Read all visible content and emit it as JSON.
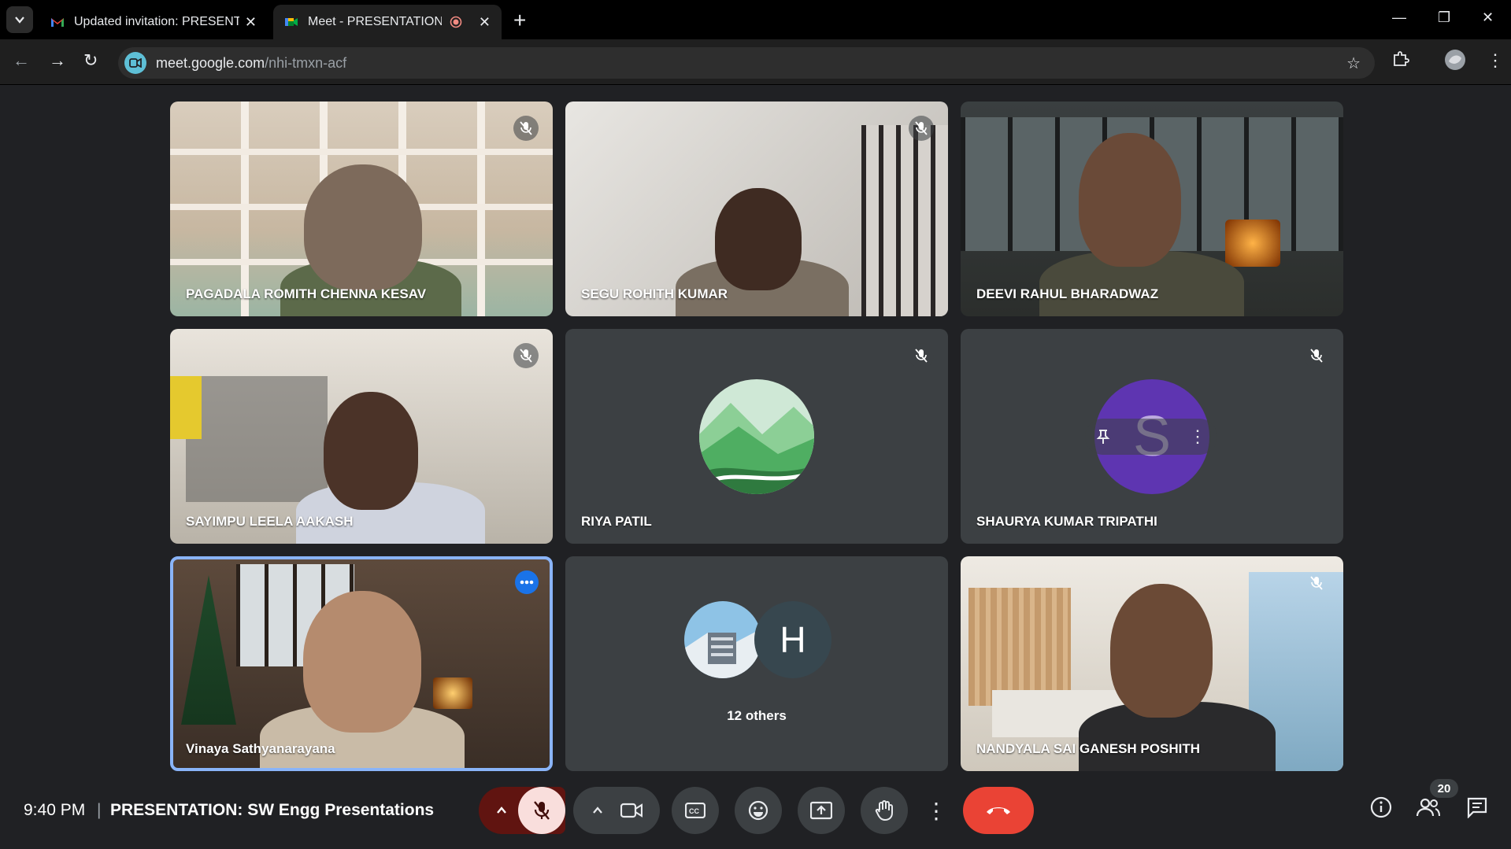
{
  "browser": {
    "tabs": [
      {
        "title": "Updated invitation: PRESENTATI",
        "favicon": "gmail-icon"
      },
      {
        "title": "Meet - PRESENTATION: SW",
        "favicon": "meet-icon"
      }
    ],
    "url_host": "meet.google.com",
    "url_path": "/nhi-tmxn-acf"
  },
  "tiles": [
    {
      "name": "PAGADALA ROMITH CHENNA KESAV"
    },
    {
      "name": "SEGU ROHITH KUMAR"
    },
    {
      "name": "DEEVI RAHUL BHARADWAZ"
    },
    {
      "name": "SAYIMPU LEELA AAKASH"
    },
    {
      "name": "RIYA PATIL"
    },
    {
      "name": "SHAURYA KUMAR TRIPATHI",
      "avatar_letter": "S"
    },
    {
      "name": "Vinaya Sathyanarayana"
    },
    {
      "others_label": "12 others",
      "avatar_letter": "H"
    },
    {
      "name": "NANDYALA SAI GANESH POSHITH"
    }
  ],
  "bottombar": {
    "time": "9:40 PM",
    "separator": "|",
    "meeting_title": "PRESENTATION: SW Engg Presentations",
    "participant_count": "20"
  },
  "colors": {
    "accent_blue": "#8ab4f8",
    "end_call_red": "#ea4335",
    "mic_off_bg": "#f9dedc"
  }
}
